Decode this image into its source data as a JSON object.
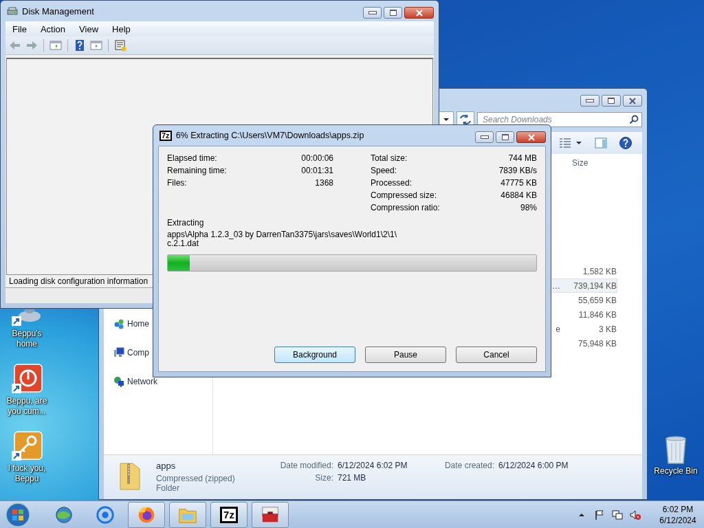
{
  "desktop_icons": [
    {
      "kind": "home",
      "label": "Beppu's home"
    },
    {
      "kind": "power",
      "label": "Beppu, are you cum..."
    },
    {
      "kind": "key",
      "label": "I fuck you, Beppu"
    }
  ],
  "recycle_bin": {
    "label": "Recycle Bin"
  },
  "explorer": {
    "search": {
      "placeholder": "Search Downloads"
    },
    "column_header": "Size",
    "rows": [
      {
        "size": "1,582 KB",
        "selected": false
      },
      {
        "name": "…",
        "size": "739,194 KB",
        "selected": true
      },
      {
        "size": "55,659 KB",
        "selected": false
      },
      {
        "size": "11,846 KB",
        "selected": false
      },
      {
        "name": "e",
        "size": "3 KB",
        "selected": false
      },
      {
        "size": "75,948 KB",
        "selected": false
      }
    ],
    "nav": [
      {
        "kind": "homegroup",
        "label": "Home"
      },
      {
        "kind": "computer",
        "label": "Comp"
      },
      {
        "kind": "network",
        "label": "Network"
      }
    ],
    "details": {
      "name": "apps",
      "type": "Compressed (zipped) Folder",
      "columns": [
        [
          {
            "label": "Date modified:",
            "value": "6/12/2024 6:02 PM"
          },
          {
            "label": "Size:",
            "value": "721 MB"
          }
        ],
        [
          {
            "label": "Date created:",
            "value": "6/12/2024 6:00 PM"
          }
        ]
      ]
    }
  },
  "disk_management": {
    "title": "Disk Management",
    "menu": [
      "File",
      "Action",
      "View",
      "Help"
    ],
    "status": "Loading disk configuration information"
  },
  "extract_dialog": {
    "app_icon": "7z",
    "title": "6% Extracting C:\\Users\\VM7\\Downloads\\apps.zip",
    "left_stats": [
      {
        "label": "Elapsed time:",
        "value": "00:00:06"
      },
      {
        "label": "Remaining time:",
        "value": "00:01:31"
      },
      {
        "label": "Files:",
        "value": "1368"
      }
    ],
    "right_stats": [
      {
        "label": "Total size:",
        "value": "744 MB"
      },
      {
        "label": "Speed:",
        "value": "7839 KB/s"
      },
      {
        "label": "Processed:",
        "value": "47775 KB"
      },
      {
        "label": "Compressed size:",
        "value": "46884 KB"
      },
      {
        "label": "Compression ratio:",
        "value": "98%"
      }
    ],
    "action": "Extracting",
    "path_lines": [
      "apps\\Alpha 1.2.3_03 by DarrenTan3375\\jars\\saves\\World1\\2\\1\\",
      "c.2.1.dat"
    ],
    "progress": {
      "level": 0.06
    },
    "buttons": [
      {
        "label": "Background",
        "focused": true
      },
      {
        "label": "Pause",
        "focused": false
      },
      {
        "label": "Cancel",
        "focused": false
      }
    ]
  },
  "taskbar": {
    "items": [
      {
        "kind": "ie",
        "open": false
      },
      {
        "kind": "chrome",
        "open": false
      },
      {
        "kind": "firefox",
        "open": true
      },
      {
        "kind": "explorer",
        "open": true
      },
      {
        "kind": "sevenzip",
        "open": true,
        "label": "7z"
      },
      {
        "kind": "toolbox",
        "open": true
      }
    ],
    "clock": {
      "time": "6:02 PM",
      "date": "6/12/2024"
    }
  }
}
